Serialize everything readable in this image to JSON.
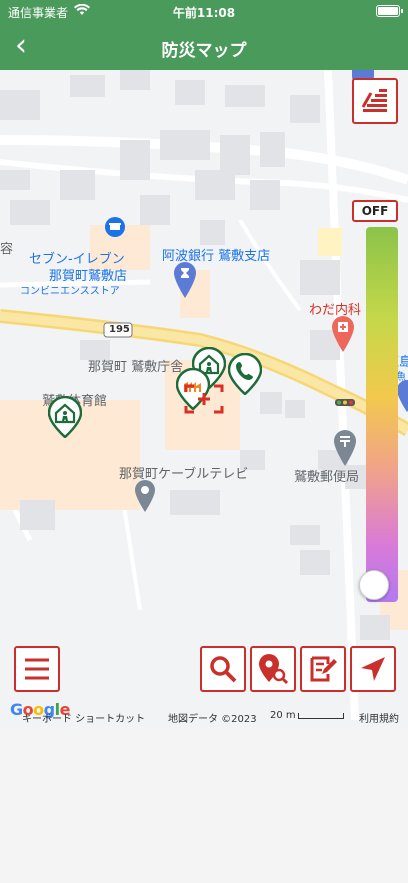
{
  "status": {
    "carrier": "通信事業者",
    "time": "午前11:08"
  },
  "nav": {
    "back_label": "‹",
    "title": "防災マップ"
  },
  "map": {
    "labels": {
      "seven_1": "セブン-イレブン",
      "seven_2": "那賀町鷲敷店",
      "seven_3": "コンビニエンスストア",
      "bank": "阿波銀行 鷲敷支店",
      "clinic": "わだ内科",
      "town_office": "那賀町 鷲敷庁舎",
      "gym": "鷲敷体育館",
      "cable": "那賀町ケーブルテレビ",
      "post": "鷲敷郵便局",
      "route": "195",
      "edge_left": "容",
      "edge_right_1": "徳島",
      "edge_right_2": "鮮魚"
    },
    "off_label": "OFF"
  },
  "footer": {
    "google": "Google",
    "shortcut": "キーボード ショートカット",
    "data": "地図データ ©2023",
    "scale": "20 m",
    "terms": "利用規約"
  },
  "colors": {
    "header": "#4a9a5c",
    "button_border": "#c9302c",
    "shelter": "#1e6b3a"
  }
}
